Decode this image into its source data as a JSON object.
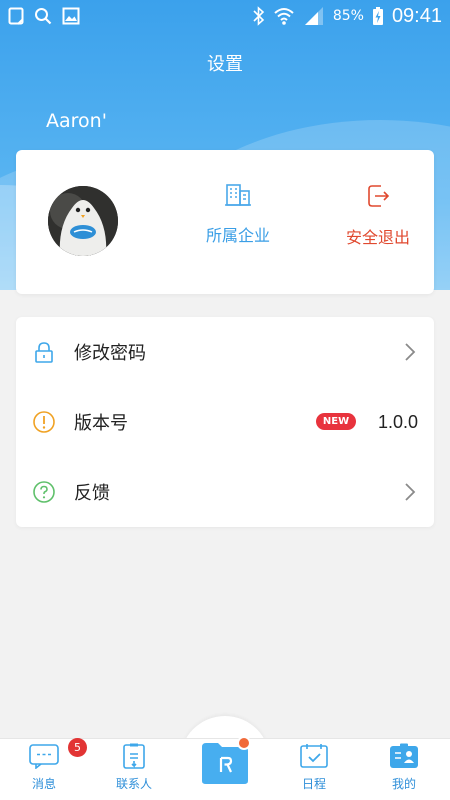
{
  "status_bar": {
    "battery": "85%",
    "time": "09:41"
  },
  "header": {
    "title": "设置",
    "username": "Aaron'"
  },
  "profile_card": {
    "company_label": "所属企业",
    "logout_label": "安全退出"
  },
  "menu": {
    "items": [
      {
        "label": "修改密码"
      },
      {
        "label": "版本号",
        "badge": "NEW",
        "value": "1.0.0"
      },
      {
        "label": "反馈"
      }
    ]
  },
  "bottom_nav": {
    "items": [
      {
        "label": "消息",
        "badge": "5"
      },
      {
        "label": "联系人"
      },
      {
        "label": ""
      },
      {
        "label": "日程"
      },
      {
        "label": "我的"
      }
    ]
  },
  "colors": {
    "primary": "#3ba1ec",
    "accent_red": "#e0492f",
    "nav_blue": "#2f8fd9",
    "badge_red": "#e23434"
  }
}
